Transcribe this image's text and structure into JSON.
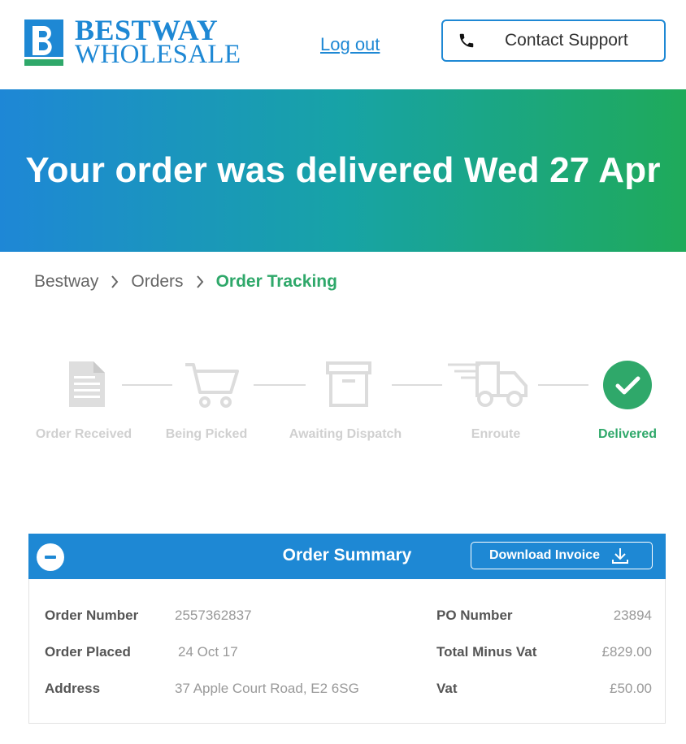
{
  "header": {
    "logo": {
      "line1": "BESTWAY",
      "line2": "WHOLESALE"
    },
    "logout_label": "Log out",
    "support_label": "Contact Support"
  },
  "banner": {
    "title": "Your order was delivered Wed 27 Apr"
  },
  "breadcrumb": [
    {
      "label": "Bestway"
    },
    {
      "label": "Orders"
    },
    {
      "label": "Order Tracking"
    }
  ],
  "tracking": {
    "steps": [
      {
        "label": "Order Received",
        "icon": "document-icon",
        "state": "inactive"
      },
      {
        "label": "Being Picked",
        "icon": "cart-icon",
        "state": "inactive"
      },
      {
        "label": "Awaiting Dispatch",
        "icon": "box-icon",
        "state": "inactive"
      },
      {
        "label": "Enroute",
        "icon": "truck-icon",
        "state": "inactive"
      },
      {
        "label": "Delivered",
        "icon": "check-icon",
        "state": "active"
      }
    ]
  },
  "summary": {
    "title": "Order Summary",
    "download_label": "Download Invoice",
    "fields": {
      "order_number": {
        "label": "Order Number",
        "value": "2557362837"
      },
      "order_placed": {
        "label": "Order Placed",
        "value": "24 Oct 17"
      },
      "address": {
        "label": "Address",
        "value": "37 Apple Court Road, E2 6SG"
      },
      "po_number": {
        "label": "PO Number",
        "value": "23894"
      },
      "total_minus_vat": {
        "label": "Total Minus Vat",
        "value": "£829.00"
      },
      "vat": {
        "label": "Vat",
        "value": "£50.00"
      }
    }
  },
  "colors": {
    "brand_blue": "#1e88d4",
    "success_green": "#2fa86a",
    "inactive_gray": "#d0d0d0"
  }
}
